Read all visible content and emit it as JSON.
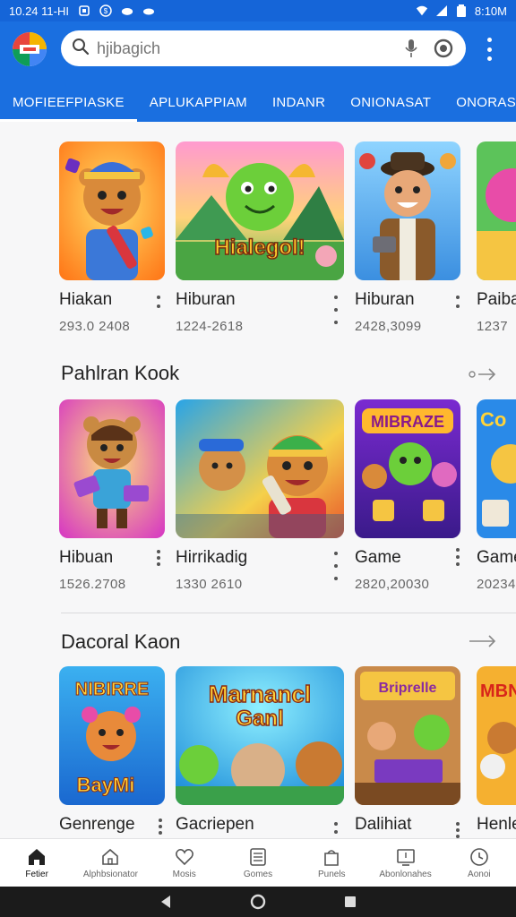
{
  "status_bar": {
    "time_left": "10.24 11-HI",
    "time_right": "8:10M"
  },
  "search": {
    "placeholder": "hjibagich"
  },
  "tabs": [
    {
      "label": "MOFIEEFPIASKE",
      "active": true
    },
    {
      "label": "APLUKAPPIAM",
      "active": false
    },
    {
      "label": "INDANR",
      "active": false
    },
    {
      "label": "ONIONASAT",
      "active": false
    },
    {
      "label": "ONORASIS",
      "active": false
    }
  ],
  "sections": [
    {
      "title": "",
      "cards": [
        {
          "title": "Hiakan",
          "meta": "293.0 2408"
        },
        {
          "title": "Hiburan",
          "meta": "1224-2618"
        },
        {
          "title": "Hiburan",
          "meta": "2428,3099"
        },
        {
          "title": "Paiba",
          "meta": "1237"
        }
      ]
    },
    {
      "title": "Pahlran Kook",
      "cards": [
        {
          "title": "Hibuan",
          "meta": "1526.2708"
        },
        {
          "title": "Hirrikadig",
          "meta": "1330 2610"
        },
        {
          "title": "Game",
          "meta": "2820,20030"
        },
        {
          "title": "Game",
          "meta": "20234"
        }
      ]
    },
    {
      "title": "Dacoral Kaon",
      "cards": [
        {
          "title": "Genrenge",
          "meta": ""
        },
        {
          "title": "Gacriepen",
          "meta": ""
        },
        {
          "title": "Dalihiat",
          "meta": ""
        },
        {
          "title": "Henle",
          "meta": ""
        }
      ]
    }
  ],
  "thumb_text": {
    "s1c2": "Hialegol!",
    "s2c3": "MIBRAZE",
    "s2c4": "Co",
    "s3c1_top": "NIBIRRE",
    "s3c1_bottom": "BayMi",
    "s3c2_top": "Marnancl",
    "s3c2_bottom": "Ganl",
    "s3c3": "Briprelle",
    "s3c4": "MBN"
  },
  "bottom_nav": [
    {
      "label": "Fetier",
      "icon": "home-icon",
      "active": true
    },
    {
      "label": "Alphbsionator",
      "icon": "house-outline-icon",
      "active": false
    },
    {
      "label": "Mosis",
      "icon": "heart-icon",
      "active": false
    },
    {
      "label": "Gomes",
      "icon": "list-icon",
      "active": false
    },
    {
      "label": "Punels",
      "icon": "bag-icon",
      "active": false
    },
    {
      "label": "Abonlonahes",
      "icon": "screen-icon",
      "active": false
    },
    {
      "label": "Aonoi",
      "icon": "clock-icon",
      "active": false
    }
  ],
  "colors": {
    "header": "#1a6fe0",
    "status": "#1565d8"
  }
}
